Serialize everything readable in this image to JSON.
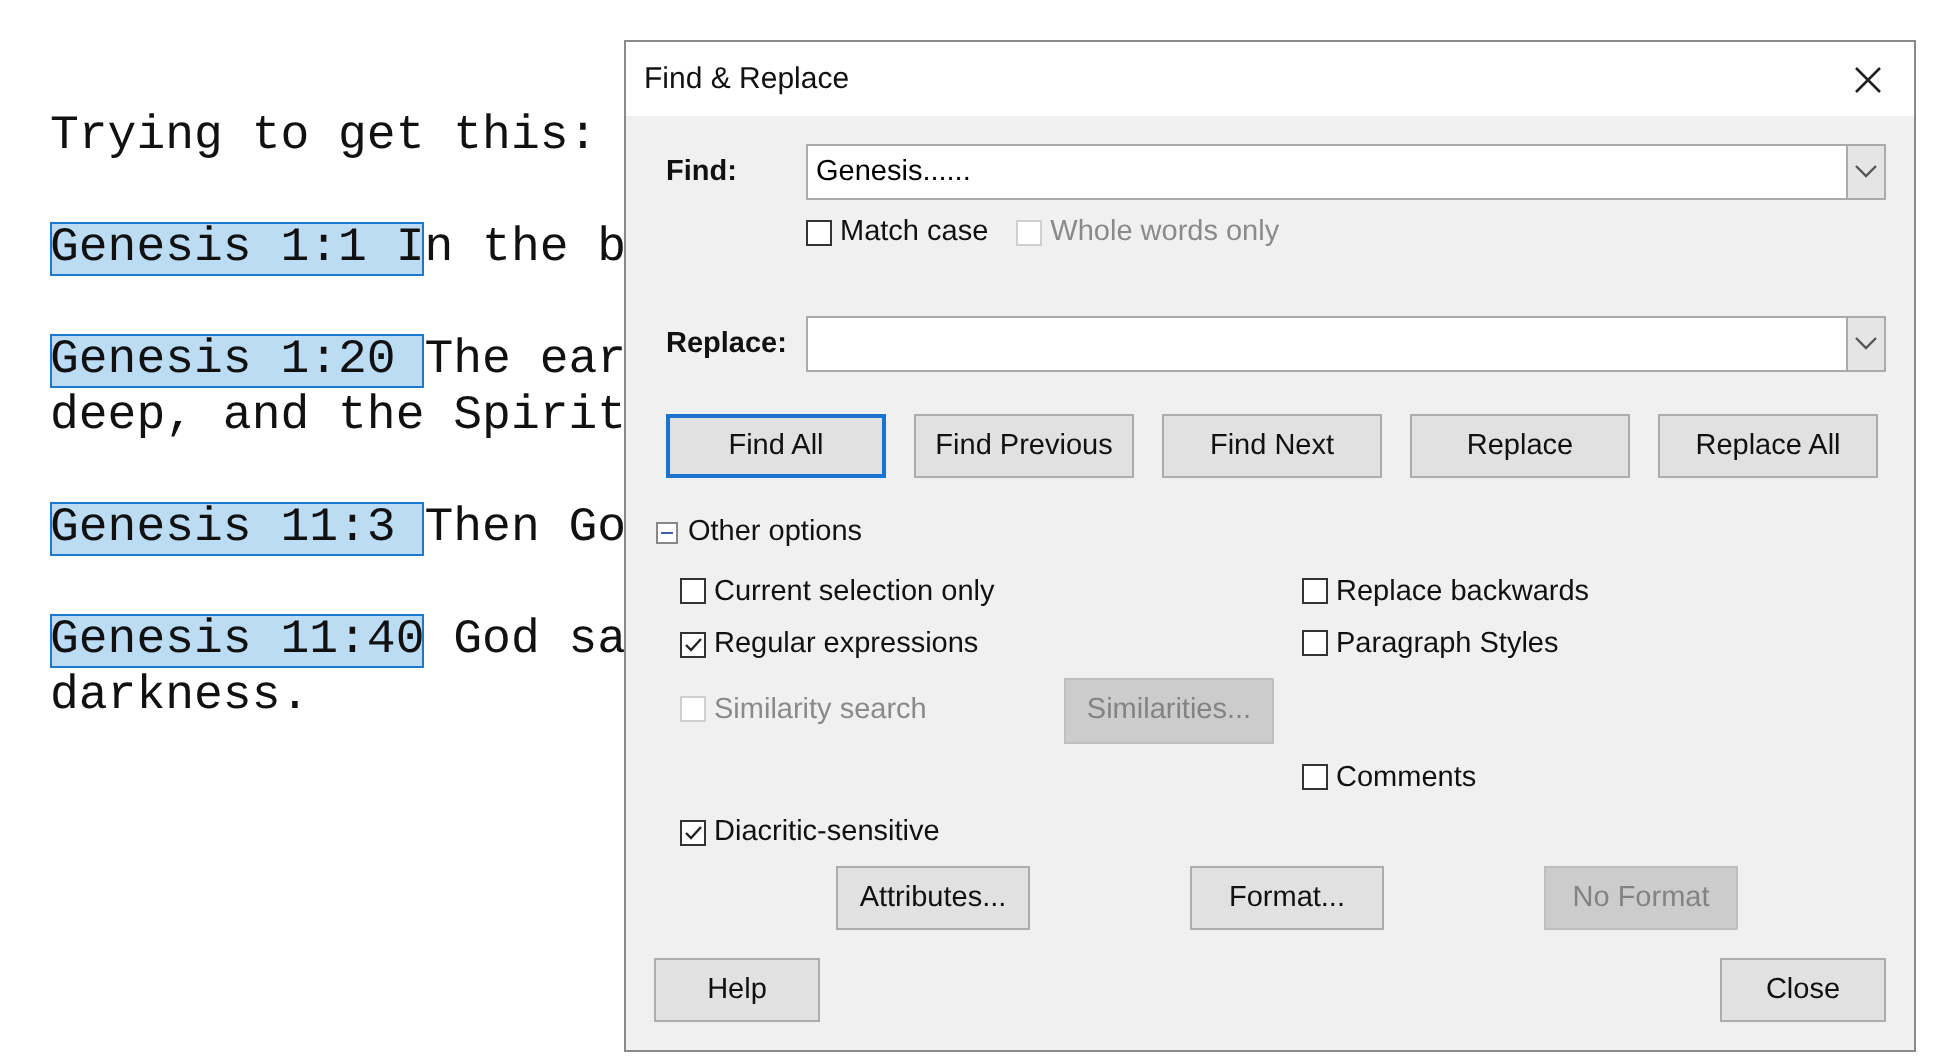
{
  "document": {
    "paragraphs": [
      {
        "lines": [
          {
            "text": "Trying to get this:"
          }
        ]
      },
      {
        "lines": [
          {
            "highlight": "Genesis 1:1 I",
            "text": "n the b"
          }
        ]
      },
      {
        "lines": [
          {
            "highlight": "Genesis 1:20 ",
            "text": "The ear"
          },
          {
            "text": "deep, and the Spirit"
          }
        ]
      },
      {
        "lines": [
          {
            "highlight": "Genesis 11:3 ",
            "text": "Then Go"
          }
        ]
      },
      {
        "lines": [
          {
            "highlight": "Genesis 11:40",
            "text": " God sa"
          },
          {
            "text": "darkness."
          }
        ]
      }
    ]
  },
  "dialog": {
    "title": "Find & Replace",
    "find": {
      "label": "Find:",
      "value": "Genesis......"
    },
    "find_options": [
      {
        "label": "Match case",
        "checked": false,
        "disabled": false
      },
      {
        "label": "Whole words only",
        "checked": false,
        "disabled": true
      }
    ],
    "replace": {
      "label": "Replace:"
    },
    "action_buttons": [
      {
        "label": "Find All",
        "focused": true
      },
      {
        "label": "Find Previous",
        "focused": false
      },
      {
        "label": "Find Next",
        "focused": false
      },
      {
        "label": "Replace",
        "focused": false
      },
      {
        "label": "Replace All",
        "focused": false
      }
    ],
    "other_options": {
      "label": "Other options",
      "expanded": true
    },
    "option_rows": [
      {
        "left": {
          "label": "Current selection only",
          "checked": false,
          "disabled": false
        },
        "right": {
          "label": "Replace backwards",
          "checked": false,
          "disabled": false
        }
      },
      {
        "left": {
          "label": "Regular expressions",
          "checked": true,
          "disabled": false
        },
        "right": {
          "label": "Paragraph Styles",
          "checked": false,
          "disabled": false
        }
      },
      {
        "left": {
          "label": "Similarity search",
          "checked": false,
          "disabled": true
        },
        "button": {
          "label": "Similarities...",
          "disabled": true
        }
      },
      {
        "right": {
          "label": "Comments",
          "checked": false,
          "disabled": false
        }
      },
      {
        "left": {
          "label": "Diacritic-sensitive",
          "checked": true,
          "disabled": false
        }
      }
    ],
    "format_buttons": [
      {
        "label": "Attributes...",
        "disabled": false
      },
      {
        "label": "Format...",
        "disabled": false
      },
      {
        "label": "No Format",
        "disabled": true
      }
    ],
    "footer_buttons": [
      {
        "label": "Help"
      },
      {
        "label": "Close"
      }
    ]
  }
}
